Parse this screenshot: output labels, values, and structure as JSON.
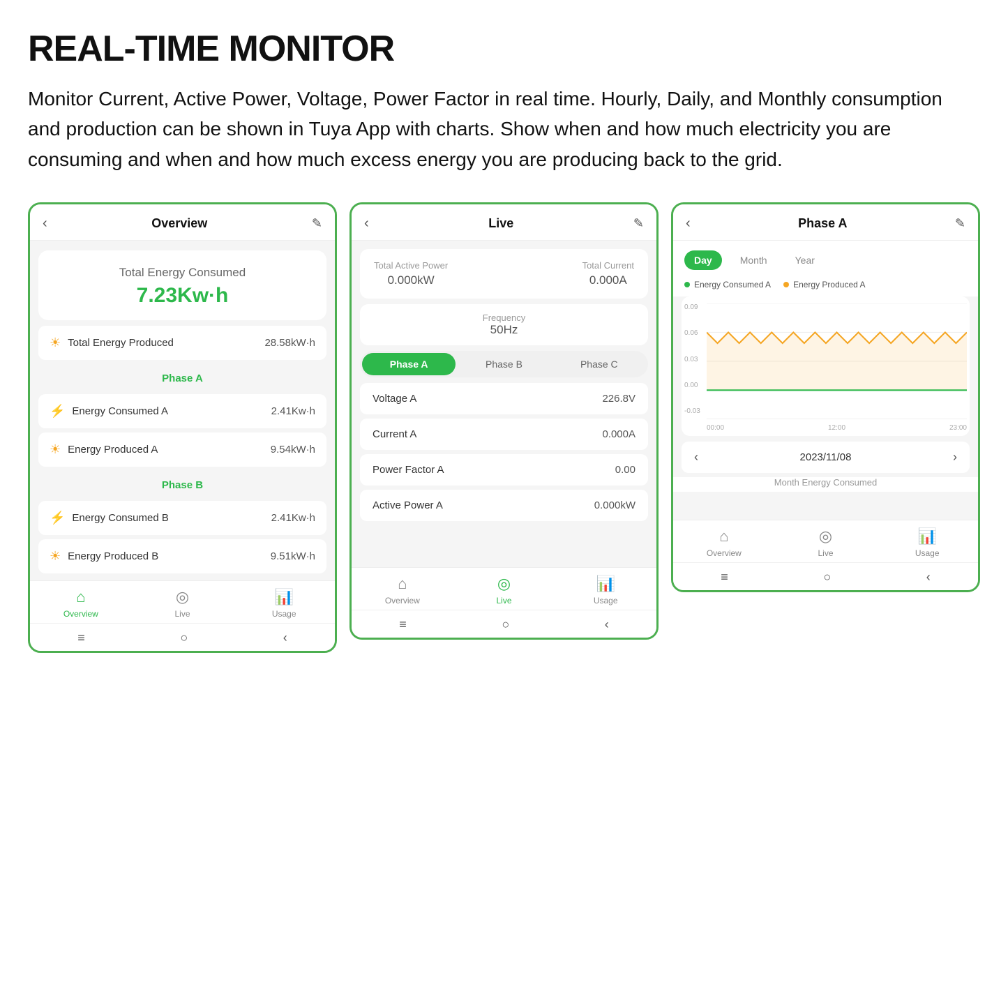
{
  "page": {
    "title": "REAL-TIME MONITOR",
    "description": "Monitor Current, Active Power, Voltage, Power Factor in real time. Hourly, Daily, and Monthly consumption and production can be shown in Tuya App with charts. Show when and how much electricity you are consuming and when and how much excess energy you are producing back to the grid."
  },
  "screen1": {
    "title": "Overview",
    "hero_label": "Total Energy Consumed",
    "hero_value": "7.23Kw·h",
    "rows": [
      {
        "icon": "sun",
        "label": "Total Energy Produced",
        "value": "28.58kW·h"
      }
    ],
    "phase_a": {
      "header": "Phase A",
      "rows": [
        {
          "icon": "bolt",
          "label": "Energy Consumed A",
          "value": "2.41Kw·h"
        },
        {
          "icon": "sun",
          "label": "Energy Produced A",
          "value": "9.54kW·h"
        }
      ]
    },
    "phase_b": {
      "header": "Phase B",
      "rows": [
        {
          "icon": "bolt",
          "label": "Energy Consumed B",
          "value": "2.41Kw·h"
        },
        {
          "icon": "sun",
          "label": "Energy Produced B",
          "value": "9.51kW·h"
        }
      ]
    },
    "nav": [
      {
        "label": "Overview",
        "active": true
      },
      {
        "label": "Live",
        "active": false
      },
      {
        "label": "Usage",
        "active": false
      }
    ]
  },
  "screen2": {
    "title": "Live",
    "total_active_power_label": "Total Active Power",
    "total_active_power_value": "0.000kW",
    "total_current_label": "Total Current",
    "total_current_value": "0.000A",
    "frequency_label": "Frequency",
    "frequency_value": "50Hz",
    "phase_tabs": [
      {
        "label": "Phase A",
        "active": true
      },
      {
        "label": "Phase B",
        "active": false
      },
      {
        "label": "Phase C",
        "active": false
      }
    ],
    "metrics": [
      {
        "label": "Voltage A",
        "value": "226.8V"
      },
      {
        "label": "Current A",
        "value": "0.000A"
      },
      {
        "label": "Power Factor A",
        "value": "0.00"
      },
      {
        "label": "Active Power A",
        "value": "0.000kW"
      }
    ],
    "nav": [
      {
        "label": "Overview",
        "active": false
      },
      {
        "label": "Live",
        "active": true
      },
      {
        "label": "Usage",
        "active": false
      }
    ]
  },
  "screen3": {
    "title": "Phase A",
    "chart_tabs": [
      {
        "label": "Day",
        "active": true
      },
      {
        "label": "Month",
        "active": false
      },
      {
        "label": "Year",
        "active": false
      }
    ],
    "legend": [
      {
        "label": "Energy Consumed A",
        "color": "#2db84b"
      },
      {
        "label": "Energy Produced A",
        "color": "#f5a623"
      }
    ],
    "y_labels": [
      "0.09",
      "0.06",
      "0.03",
      "0.00",
      "-0.03"
    ],
    "x_labels": [
      "00:00",
      "12:00",
      "23:00"
    ],
    "date": "2023/11/08",
    "month_energy_label": "Month Energy Consumed",
    "nav": [
      {
        "label": "Overview",
        "active": false
      },
      {
        "label": "Live",
        "active": false
      },
      {
        "label": "Usage",
        "active": false
      }
    ]
  },
  "icons": {
    "sun": "☀",
    "bolt": "⚡",
    "home": "⌂",
    "wifi": "◎",
    "chart": "📊",
    "back": "‹",
    "edit": "✎",
    "menu": "≡",
    "circle": "○",
    "chevron_left": "‹",
    "chevron_right": "›",
    "android_menu": "≡",
    "android_home": "○",
    "android_back": "‹"
  }
}
